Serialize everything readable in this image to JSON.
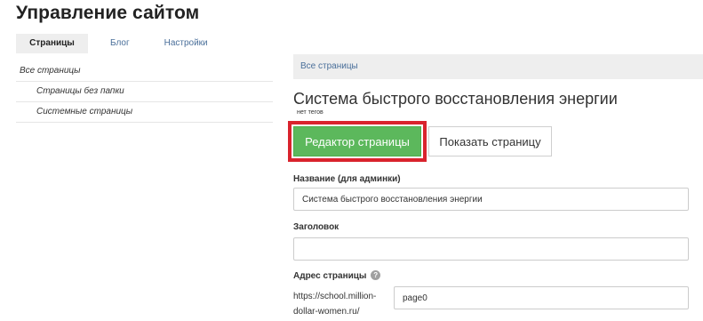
{
  "header": {
    "title": "Управление сайтом"
  },
  "tabs": [
    {
      "label": "Страницы",
      "active": true
    },
    {
      "label": "Блог",
      "active": false
    },
    {
      "label": "Настройки",
      "active": false
    }
  ],
  "sidebar": {
    "items": [
      {
        "label": "Все страницы"
      },
      {
        "label": "Страницы без папки"
      },
      {
        "label": "Системные страницы"
      }
    ]
  },
  "breadcrumb": {
    "label": "Все страницы"
  },
  "page": {
    "title": "Система быстрого восстановления энергии",
    "tags_text": "нет тегов"
  },
  "buttons": {
    "editor": "Редактор страницы",
    "show": "Показать страницу"
  },
  "form": {
    "name_label": "Название (для админки)",
    "name_value": "Система быстрого восстановления энергии",
    "heading_label": "Заголовок",
    "heading_value": "",
    "address_label": "Адрес страницы",
    "address_help_icon": "?",
    "address_prefix": "https://school.million-dollar-women.ru/",
    "address_value": "page0"
  },
  "colors": {
    "accent_green": "#5cb85c",
    "highlight_red": "#d9232d",
    "link_blue": "#4a6f9a"
  }
}
